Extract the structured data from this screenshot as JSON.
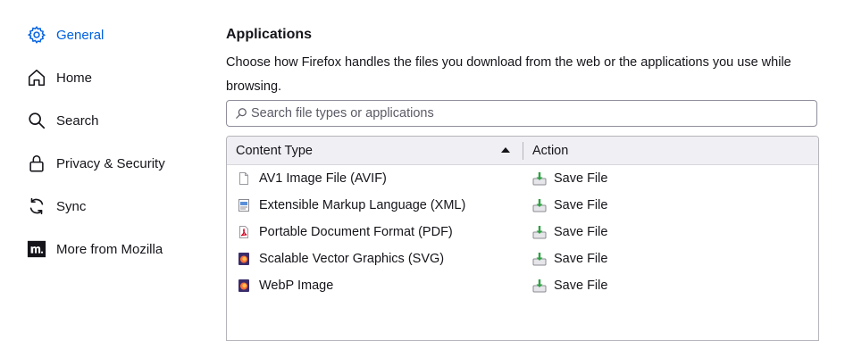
{
  "sidebar": {
    "items": [
      {
        "label": "General",
        "icon": "gear-icon",
        "active": true
      },
      {
        "label": "Home",
        "icon": "home-icon"
      },
      {
        "label": "Search",
        "icon": "search-icon"
      },
      {
        "label": "Privacy & Security",
        "icon": "lock-icon"
      },
      {
        "label": "Sync",
        "icon": "sync-icon"
      },
      {
        "label": "More from Mozilla",
        "icon": "mozilla-icon"
      }
    ]
  },
  "applications": {
    "title": "Applications",
    "description": "Choose how Firefox handles the files you download from the web or the applications you use while browsing.",
    "search_placeholder": "Search file types or applications",
    "columns": {
      "content_type": "Content Type",
      "action": "Action"
    },
    "rows": [
      {
        "type": "AV1 Image File (AVIF)",
        "icon": "blank-file-icon",
        "action": "Save File"
      },
      {
        "type": "Extensible Markup Language (XML)",
        "icon": "xml-file-icon",
        "action": "Save File"
      },
      {
        "type": "Portable Document Format (PDF)",
        "icon": "pdf-icon",
        "action": "Save File"
      },
      {
        "type": "Scalable Vector Graphics (SVG)",
        "icon": "firefox-file-icon",
        "action": "Save File"
      },
      {
        "type": "WebP Image",
        "icon": "firefox-file-icon",
        "action": "Save File"
      }
    ]
  },
  "colors": {
    "accent": "#0061e0",
    "text": "#15141a"
  }
}
